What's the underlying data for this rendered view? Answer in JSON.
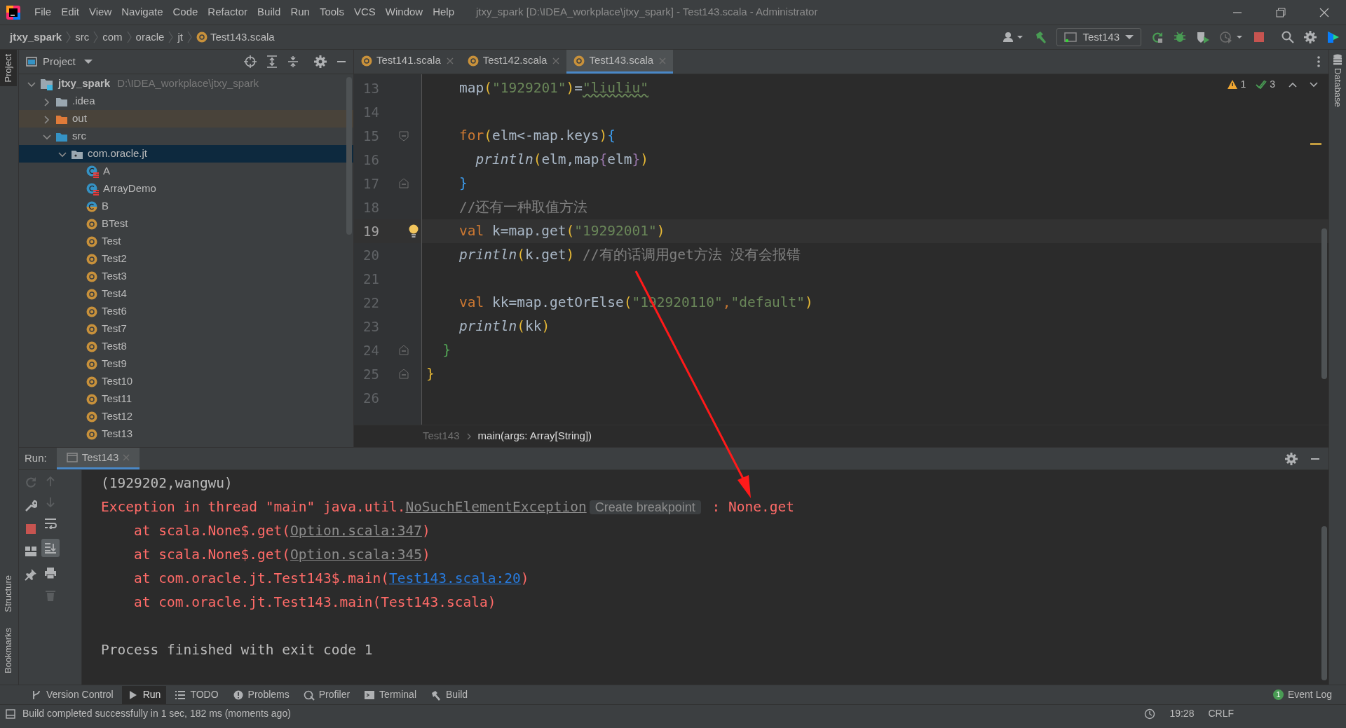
{
  "window": {
    "title": "jtxy_spark [D:\\IDEA_workplace\\jtxy_spark] - Test143.scala - Administrator"
  },
  "menu": [
    "File",
    "Edit",
    "View",
    "Navigate",
    "Code",
    "Refactor",
    "Build",
    "Run",
    "Tools",
    "VCS",
    "Window",
    "Help"
  ],
  "nav_bar": {
    "breadcrumbs": [
      "jtxy_spark",
      "src",
      "com",
      "oracle",
      "jt",
      "Test143.scala"
    ],
    "run_config": "Test143"
  },
  "left_strip": [
    {
      "label": "Project",
      "selected": true
    },
    {
      "label": "Structure",
      "selected": false
    },
    {
      "label": "Bookmarks",
      "selected": false
    }
  ],
  "right_strip": [
    {
      "label": "Database"
    }
  ],
  "project": {
    "title": "Project",
    "tree": [
      {
        "label": "jtxy_spark",
        "path": "D:\\IDEA_workplace\\jtxy_spark",
        "kind": "module",
        "expanded": true,
        "selected": false,
        "children": [
          {
            "label": ".idea",
            "kind": "folder",
            "expanded": false,
            "selected": false
          },
          {
            "label": "out",
            "kind": "excluded",
            "expanded": false,
            "selected": false
          },
          {
            "label": "src",
            "kind": "source",
            "expanded": true,
            "selected": false,
            "children": [
              {
                "label": "com.oracle.jt",
                "kind": "package",
                "expanded": true,
                "selected": true,
                "children": [
                  {
                    "label": "A",
                    "kind": "class-error",
                    "selected": false
                  },
                  {
                    "label": "ArrayDemo",
                    "kind": "class-error",
                    "selected": false
                  },
                  {
                    "label": "B",
                    "kind": "class",
                    "selected": false
                  },
                  {
                    "label": "BTest",
                    "kind": "object",
                    "selected": false
                  },
                  {
                    "label": "Test",
                    "kind": "object",
                    "selected": false
                  },
                  {
                    "label": "Test2",
                    "kind": "object",
                    "selected": false
                  },
                  {
                    "label": "Test3",
                    "kind": "object",
                    "selected": false
                  },
                  {
                    "label": "Test4",
                    "kind": "object",
                    "selected": false
                  },
                  {
                    "label": "Test6",
                    "kind": "object",
                    "selected": false
                  },
                  {
                    "label": "Test7",
                    "kind": "object",
                    "selected": false
                  },
                  {
                    "label": "Test8",
                    "kind": "object",
                    "selected": false
                  },
                  {
                    "label": "Test9",
                    "kind": "object",
                    "selected": false
                  },
                  {
                    "label": "Test10",
                    "kind": "object",
                    "selected": false
                  },
                  {
                    "label": "Test11",
                    "kind": "object",
                    "selected": false
                  },
                  {
                    "label": "Test12",
                    "kind": "object",
                    "selected": false
                  },
                  {
                    "label": "Test13",
                    "kind": "object",
                    "selected": false
                  }
                ]
              }
            ]
          }
        ]
      }
    ]
  },
  "editor": {
    "tabs": [
      {
        "label": "Test141.scala",
        "selected": false
      },
      {
        "label": "Test142.scala",
        "selected": false
      },
      {
        "label": "Test143.scala",
        "selected": true
      }
    ],
    "inspections": {
      "warnings": "1",
      "passed": "3"
    },
    "lines": [
      {
        "number": "13",
        "kind": "code",
        "current": false,
        "bulb": false,
        "tokens": [
          {
            "kind": "text",
            "text": "    map"
          },
          {
            "kind": "paren",
            "text": "("
          },
          {
            "kind": "string",
            "text": "\"1929201\""
          },
          {
            "kind": "paren",
            "text": ")"
          },
          {
            "kind": "text",
            "text": "="
          },
          {
            "kind": "typo",
            "text": "\"liuliu\""
          }
        ]
      },
      {
        "number": "14",
        "kind": "code",
        "current": false,
        "bulb": false
      },
      {
        "number": "15",
        "kind": "fold-start",
        "current": false,
        "bulb": false,
        "tokens": [
          {
            "kind": "keyword",
            "text": "    for"
          },
          {
            "kind": "paren",
            "text": "("
          },
          {
            "kind": "text",
            "text": "elm<-map.keys"
          },
          {
            "kind": "paren",
            "text": ")"
          },
          {
            "kind": "brace",
            "text": "{"
          }
        ]
      },
      {
        "number": "16",
        "kind": "code",
        "current": false,
        "bulb": false,
        "tokens": [
          {
            "kind": "call",
            "text": "      println"
          },
          {
            "kind": "paren",
            "text": "("
          },
          {
            "kind": "text",
            "text": "elm,map"
          },
          {
            "kind": "inner",
            "text": "{"
          },
          {
            "kind": "text",
            "text": "elm"
          },
          {
            "kind": "inner",
            "text": "}"
          },
          {
            "kind": "paren",
            "text": ")"
          }
        ]
      },
      {
        "number": "17",
        "kind": "fold-end",
        "current": false,
        "bulb": false,
        "tokens": [
          {
            "kind": "brace",
            "text": "    }"
          }
        ]
      },
      {
        "number": "18",
        "kind": "code",
        "current": false,
        "bulb": false,
        "tokens": [
          {
            "kind": "comment",
            "text": "    //还有一种取值方法"
          }
        ]
      },
      {
        "number": "19",
        "kind": "code",
        "current": true,
        "bulb": true,
        "tokens": [
          {
            "kind": "keyword",
            "text": "    val"
          },
          {
            "kind": "text",
            "text": " k=map.get"
          },
          {
            "kind": "paren",
            "text": "("
          },
          {
            "kind": "string",
            "text": "\"19292001\""
          },
          {
            "kind": "paren",
            "text": ")"
          }
        ]
      },
      {
        "number": "20",
        "kind": "code",
        "current": false,
        "bulb": false,
        "tokens": [
          {
            "kind": "call",
            "text": "    println"
          },
          {
            "kind": "paren",
            "text": "("
          },
          {
            "kind": "text",
            "text": "k.get"
          },
          {
            "kind": "paren",
            "text": ")"
          },
          {
            "kind": "comment",
            "text": " //有的话调用get方法 没有会报错"
          }
        ]
      },
      {
        "number": "21",
        "kind": "code",
        "current": false,
        "bulb": false
      },
      {
        "number": "22",
        "kind": "code",
        "current": false,
        "bulb": false,
        "tokens": [
          {
            "kind": "keyword",
            "text": "    val"
          },
          {
            "kind": "text",
            "text": " kk=map.getOrElse"
          },
          {
            "kind": "paren",
            "text": "("
          },
          {
            "kind": "string",
            "text": "\"192920110\""
          },
          {
            "kind": "keyword",
            "text": ","
          },
          {
            "kind": "string",
            "text": "\"default\""
          },
          {
            "kind": "paren",
            "text": ")"
          }
        ]
      },
      {
        "number": "23",
        "kind": "code",
        "current": false,
        "bulb": false,
        "tokens": [
          {
            "kind": "call",
            "text": "    println"
          },
          {
            "kind": "paren",
            "text": "("
          },
          {
            "kind": "text",
            "text": "kk"
          },
          {
            "kind": "paren",
            "text": ")"
          }
        ]
      },
      {
        "number": "24",
        "kind": "fold-end",
        "current": false,
        "bulb": false,
        "tokens": [
          {
            "kind": "outer",
            "text": "  }"
          }
        ]
      },
      {
        "number": "25",
        "kind": "fold-end",
        "current": false,
        "bulb": false,
        "tokens": [
          {
            "kind": "paren",
            "text": "}"
          }
        ]
      },
      {
        "number": "26",
        "kind": "code",
        "current": false,
        "bulb": false
      }
    ],
    "breadcrumbs": [
      "Test143",
      "main(args: Array[String])"
    ]
  },
  "run": {
    "label": "Run:",
    "tabs": [
      {
        "label": "Test143",
        "selected": true
      }
    ],
    "output": [
      {
        "kind": "plain",
        "parts": [
          {
            "kind": "text",
            "text": "(1929202,wangwu)"
          }
        ]
      },
      {
        "kind": "error",
        "parts": [
          {
            "kind": "text",
            "text": "Exception in thread \"main\" java.util."
          },
          {
            "kind": "muted-link",
            "text": "NoSuchElementException"
          },
          {
            "kind": "hint",
            "text": "Create breakpoint"
          },
          {
            "kind": "text",
            "text": " : None.get"
          }
        ]
      },
      {
        "kind": "error",
        "parts": [
          {
            "kind": "text",
            "text": "    at scala.None$.get("
          },
          {
            "kind": "muted-link",
            "text": "Option.scala:347"
          },
          {
            "kind": "text",
            "text": ")"
          }
        ]
      },
      {
        "kind": "error",
        "parts": [
          {
            "kind": "text",
            "text": "    at scala.None$.get("
          },
          {
            "kind": "muted-link",
            "text": "Option.scala:345"
          },
          {
            "kind": "text",
            "text": ")"
          }
        ]
      },
      {
        "kind": "error",
        "parts": [
          {
            "kind": "text",
            "text": "    at com.oracle.jt.Test143$.main("
          },
          {
            "kind": "link",
            "text": "Test143.scala:20"
          },
          {
            "kind": "text",
            "text": ")"
          }
        ]
      },
      {
        "kind": "error",
        "parts": [
          {
            "kind": "text",
            "text": "    at com.oracle.jt.Test143.main(Test143.scala)"
          }
        ]
      },
      {
        "kind": "blank"
      },
      {
        "kind": "plain",
        "parts": [
          {
            "kind": "text",
            "text": "Process finished with exit code 1"
          }
        ]
      }
    ]
  },
  "tool_windows": {
    "left": [
      {
        "label": "Version Control",
        "kind": "vcs",
        "selected": false
      },
      {
        "label": "Run",
        "kind": "run",
        "selected": true
      },
      {
        "label": "TODO",
        "kind": "todo",
        "selected": false
      },
      {
        "label": "Problems",
        "kind": "problems",
        "selected": false
      },
      {
        "label": "Profiler",
        "kind": "profiler",
        "selected": false
      },
      {
        "label": "Terminal",
        "kind": "terminal",
        "selected": false
      },
      {
        "label": "Build",
        "kind": "build",
        "selected": false
      }
    ],
    "right": [
      {
        "label": "Event Log",
        "badge": "1"
      }
    ]
  },
  "status_bar": {
    "message": "Build completed successfully in 1 sec, 182 ms (moments ago)",
    "time": "19:28",
    "line_separator": "CRLF"
  }
}
